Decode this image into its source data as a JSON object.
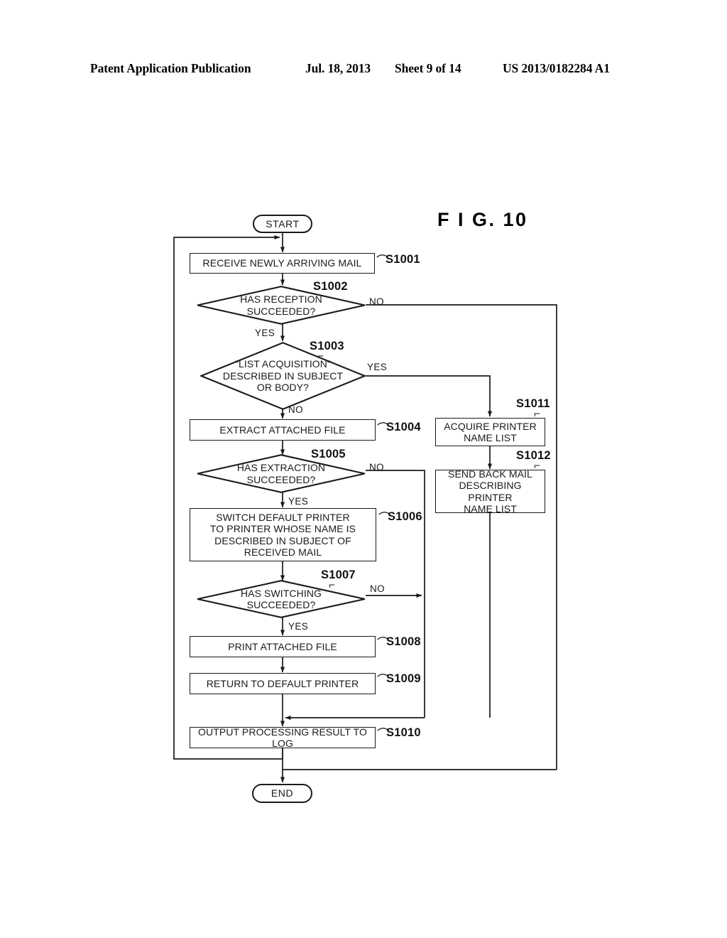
{
  "header": {
    "publication": "Patent Application Publication",
    "date": "Jul. 18, 2013",
    "sheet": "Sheet 9 of 14",
    "doc_number": "US 2013/0182284 A1"
  },
  "figure": {
    "title": "F I G.  10"
  },
  "flowchart": {
    "nodes": {
      "start": {
        "label": "START",
        "ref": ""
      },
      "s1001": {
        "label": "RECEIVE NEWLY ARRIVING MAIL",
        "ref": "S1001"
      },
      "s1002": {
        "label": "HAS RECEPTION\nSUCCEEDED?",
        "ref": "S1002"
      },
      "s1003": {
        "label": "\"LIST ACQUISITION\"\nDESCRIBED IN SUBJECT\nOR BODY?",
        "ref": "S1003"
      },
      "s1004": {
        "label": "EXTRACT ATTACHED FILE",
        "ref": "S1004"
      },
      "s1005": {
        "label": "HAS EXTRACTION\nSUCCEEDED?",
        "ref": "S1005"
      },
      "s1006": {
        "label": "SWITCH DEFAULT PRINTER\nTO PRINTER WHOSE NAME IS\nDESCRIBED IN SUBJECT OF\nRECEIVED MAIL",
        "ref": "S1006"
      },
      "s1007": {
        "label": "HAS SWITCHING\nSUCCEEDED?",
        "ref": "S1007"
      },
      "s1008": {
        "label": "PRINT ATTACHED FILE",
        "ref": "S1008"
      },
      "s1009": {
        "label": "RETURN TO DEFAULT PRINTER",
        "ref": "S1009"
      },
      "s1010": {
        "label": "OUTPUT PROCESSING RESULT TO LOG",
        "ref": "S1010"
      },
      "s1011": {
        "label": "ACQUIRE PRINTER\nNAME LIST",
        "ref": "S1011"
      },
      "s1012": {
        "label": "SEND BACK MAIL\nDESCRIBING PRINTER\nNAME LIST",
        "ref": "S1012"
      },
      "end": {
        "label": "END",
        "ref": ""
      }
    },
    "branch_labels": {
      "s1002_no": "NO",
      "s1002_yes": "YES",
      "s1003_yes": "YES",
      "s1003_no": "NO",
      "s1005_no": "NO",
      "s1005_yes": "YES",
      "s1007_no": "NO",
      "s1007_yes": "YES"
    },
    "colors": {
      "line": "#1a1a1a",
      "background": "#ffffff"
    }
  }
}
